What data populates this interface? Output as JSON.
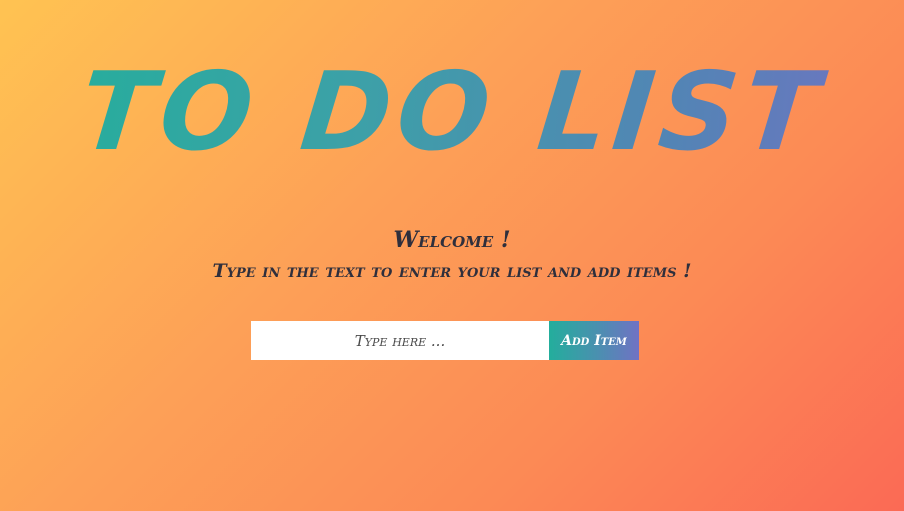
{
  "header": {
    "title": "TO DO LIST"
  },
  "intro": {
    "welcome": "Welcome !",
    "instructions": "Type in the text to enter your list and add items !"
  },
  "form": {
    "input_placeholder": "Type here ...",
    "input_value": "",
    "add_button_label": "Add Item"
  },
  "colors": {
    "background_gradient": [
      "#FFC352",
      "#FDA057",
      "#FC8A55",
      "#FB6A55"
    ],
    "title_gradient": [
      "#22B09A",
      "#5384B5",
      "#7272C3"
    ],
    "button_gradient": [
      "#23AE9C",
      "#7072C4"
    ],
    "text_dark": "#2f2f3c"
  }
}
